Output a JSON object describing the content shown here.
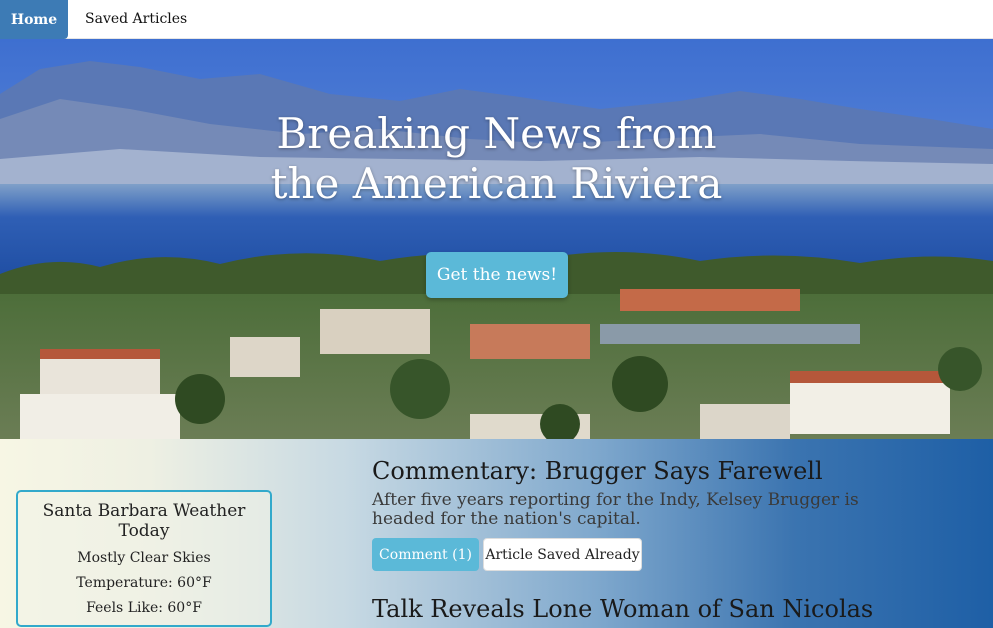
{
  "nav": {
    "home_label": "Home",
    "saved_label": "Saved Articles"
  },
  "hero": {
    "title_line1": "Breaking News from",
    "title_line2": "the American Riviera",
    "cta_label": "Get the news!"
  },
  "weather": {
    "title": "Santa Barbara Weather Today",
    "conditions": "Mostly Clear Skies",
    "temperature": "Temperature: 60°F",
    "feels_like": "Feels Like: 60°F"
  },
  "articles": [
    {
      "title": "Commentary: Brugger Says Farewell",
      "summary": "After five years reporting for the Indy, Kelsey Brugger is headed for the nation's capital.",
      "comment_label": "Comment (1)",
      "saved_label": "Article Saved Already"
    },
    {
      "title": "Talk Reveals Lone Woman of San Nicolas"
    }
  ],
  "colors": {
    "nav_active": "#3d7bb5",
    "accent_button": "#5bb9d8",
    "weather_border": "#32a9cb"
  }
}
